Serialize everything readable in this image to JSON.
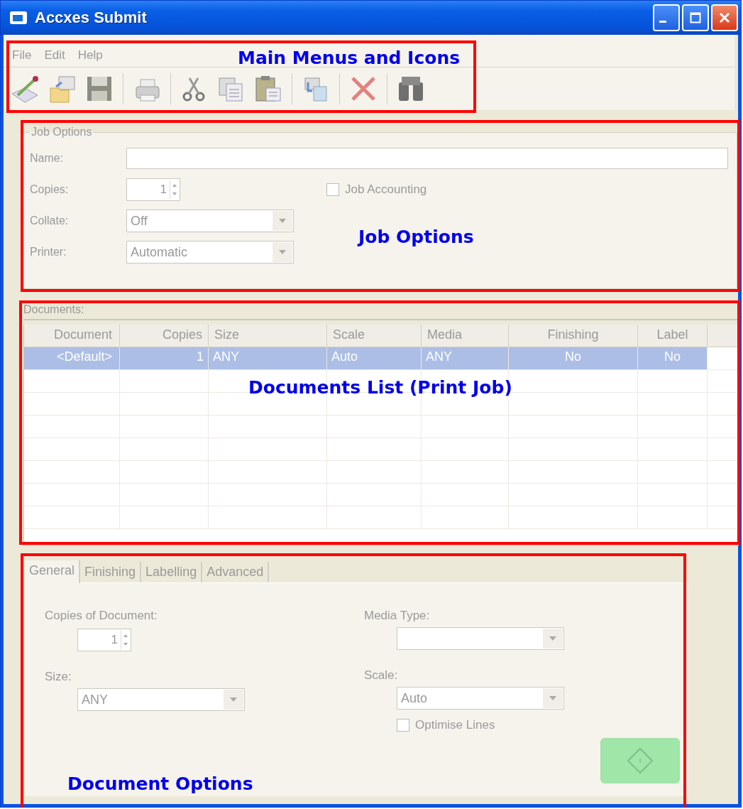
{
  "window": {
    "title": "Accxes Submit"
  },
  "menu": [
    "File",
    "Edit",
    "Help"
  ],
  "toolbar": [
    {
      "kind": "edit"
    },
    {
      "kind": "open"
    },
    {
      "kind": "save"
    },
    {
      "kind": "separator"
    },
    {
      "kind": "print"
    },
    {
      "kind": "separator"
    },
    {
      "kind": "cut"
    },
    {
      "kind": "copy"
    },
    {
      "kind": "paste"
    },
    {
      "kind": "separator"
    },
    {
      "kind": "send"
    },
    {
      "kind": "separator"
    },
    {
      "kind": "delete"
    },
    {
      "kind": "separator"
    },
    {
      "kind": "find"
    }
  ],
  "job_options": {
    "title": "Job Options",
    "name_label": "Name:",
    "copies_label": "Copies:",
    "copies": "1",
    "job_accounting": {
      "label": "Job Accounting",
      "checked": false
    },
    "collate_label": "Collate:",
    "collate": "Off",
    "printer_label": "Printer:",
    "printer": "Automatic"
  },
  "documents": {
    "label": "Documents:",
    "columns": [
      "Document",
      "Copies",
      "Size",
      "Scale",
      "Media",
      "Finishing",
      "Label"
    ],
    "rows": [
      {
        "cells": [
          "<Default>",
          "1",
          "ANY",
          "Auto",
          "ANY",
          "No",
          "No"
        ],
        "selected": true
      }
    ]
  },
  "tabs": [
    {
      "label": "General",
      "selected": true
    },
    {
      "label": "Finishing",
      "selected": false
    },
    {
      "label": "Labelling",
      "selected": false
    },
    {
      "label": "Advanced",
      "selected": false
    }
  ],
  "document_options": {
    "copies_label": "Copies of Document:",
    "copies": "1",
    "media_type_label": "Media Type:",
    "size_label": "Size:",
    "size": "ANY",
    "scale_label": "Scale:",
    "scale": "Auto",
    "optimise_lines": {
      "label": "Optimise Lines",
      "checked": false
    }
  },
  "annotations": [
    {
      "label": "Main Menus and Icons"
    },
    {
      "label": "Job Options"
    },
    {
      "label": "Documents List (Print Job)"
    },
    {
      "label": "Document Options"
    }
  ]
}
